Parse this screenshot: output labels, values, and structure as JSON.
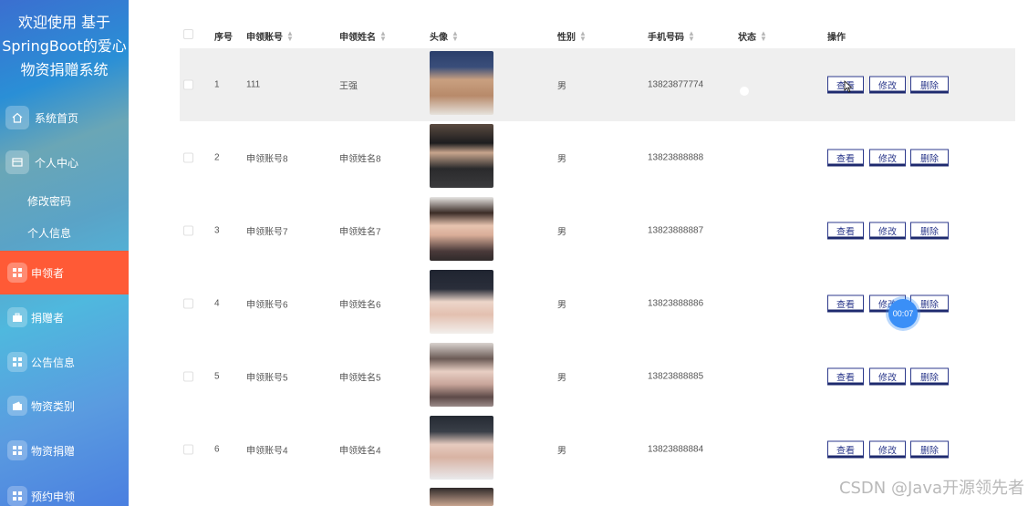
{
  "sidebar": {
    "title_line1": "欢迎使用 基于",
    "title_line2": "SpringBoot的爱心",
    "title_line3": "物资捐赠系统",
    "items": [
      {
        "label": "系统首页",
        "icon": "home-icon"
      },
      {
        "label": "个人中心",
        "icon": "card-icon"
      },
      {
        "label": "修改密码"
      },
      {
        "label": "个人信息"
      },
      {
        "label": "申领者",
        "icon": "grid-icon",
        "active": true
      },
      {
        "label": "捐赠者",
        "icon": "briefcase-icon"
      },
      {
        "label": "公告信息",
        "icon": "grid-icon"
      },
      {
        "label": "物资类别",
        "icon": "wallet-icon"
      },
      {
        "label": "物资捐赠",
        "icon": "grid-icon"
      },
      {
        "label": "预约申领",
        "icon": "grid-icon"
      }
    ]
  },
  "table": {
    "headers": [
      "序号",
      "申领账号",
      "申领姓名",
      "头像",
      "性别",
      "手机号码",
      "状态",
      "操作"
    ],
    "rows": [
      {
        "index": "1",
        "account": "111",
        "name": "王强",
        "gender": "男",
        "phone": "13823877774",
        "status_on": false
      },
      {
        "index": "2",
        "account": "申领账号8",
        "name": "申领姓名8",
        "gender": "男",
        "phone": "13823888888",
        "status_on": false
      },
      {
        "index": "3",
        "account": "申领账号7",
        "name": "申领姓名7",
        "gender": "男",
        "phone": "13823888887",
        "status_on": false
      },
      {
        "index": "4",
        "account": "申领账号6",
        "name": "申领姓名6",
        "gender": "男",
        "phone": "13823888886",
        "status_on": false
      },
      {
        "index": "5",
        "account": "申领账号5",
        "name": "申领姓名5",
        "gender": "男",
        "phone": "13823888885",
        "status_on": false
      },
      {
        "index": "6",
        "account": "申领账号4",
        "name": "申领姓名4",
        "gender": "男",
        "phone": "13823888884",
        "status_on": false
      }
    ],
    "actions": {
      "view": "查看",
      "edit": "修改",
      "delete": "删除"
    }
  },
  "overlay": {
    "timer": "00:07",
    "watermark": "CSDN @Java开源领先者"
  },
  "colors": {
    "active_menu": "#ff5a36",
    "button_border": "#2d3a8c",
    "timer_bg": "#3a8ff7"
  }
}
